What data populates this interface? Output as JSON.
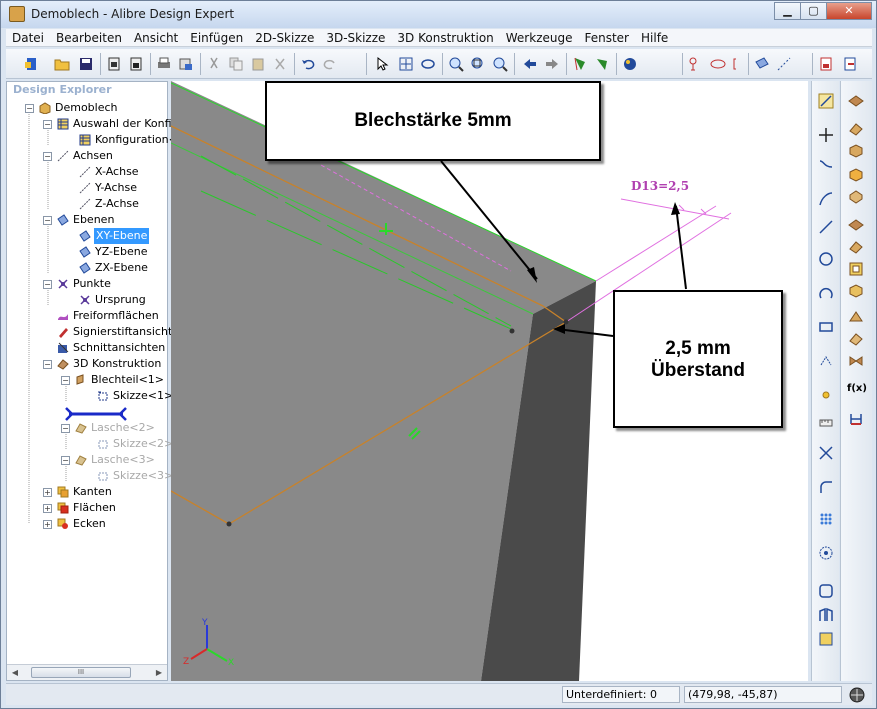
{
  "window": {
    "title": "Demoblech - Alibre Design Expert"
  },
  "menu": [
    "Datei",
    "Bearbeiten",
    "Ansicht",
    "Einfügen",
    "2D-Skizze",
    "3D-Skizze",
    "3D Konstruktion",
    "Werkzeuge",
    "Fenster",
    "Hilfe"
  ],
  "explorer": {
    "title": "Design Explorer",
    "tree": [
      {
        "label": "Demoblech",
        "icon": "part-icon"
      },
      {
        "label": "Auswahl der Konfigu",
        "icon": "table-icon"
      },
      {
        "label": "Konfiguration<1",
        "icon": "table-icon"
      },
      {
        "label": "Achsen",
        "icon": "axis-icon"
      },
      {
        "label": "X-Achse",
        "icon": "axis-icon"
      },
      {
        "label": "Y-Achse",
        "icon": "axis-icon"
      },
      {
        "label": "Z-Achse",
        "icon": "axis-icon"
      },
      {
        "label": "Ebenen",
        "icon": "plane-icon"
      },
      {
        "label": "XY-Ebene",
        "icon": "plane-icon"
      },
      {
        "label": "YZ-Ebene",
        "icon": "plane-icon"
      },
      {
        "label": "ZX-Ebene",
        "icon": "plane-icon"
      },
      {
        "label": "Punkte",
        "icon": "point-icon"
      },
      {
        "label": "Ursprung",
        "icon": "point-icon"
      },
      {
        "label": "Freiformflächen",
        "icon": "freeform-icon"
      },
      {
        "label": "Signierstiftansichten",
        "icon": "pen-icon"
      },
      {
        "label": "Schnittansichten",
        "icon": "section-icon"
      },
      {
        "label": "3D Konstruktion",
        "icon": "construction-icon"
      },
      {
        "label": "Blechteil<1>",
        "icon": "sheetmetal-icon"
      },
      {
        "label": "Skizze<1>",
        "icon": "sketch-icon"
      },
      {
        "label": "Lasche<2>",
        "icon": "tab-icon"
      },
      {
        "label": "Skizze<2>",
        "icon": "sketch-icon"
      },
      {
        "label": "Lasche<3>",
        "icon": "tab-icon"
      },
      {
        "label": "Skizze<3>",
        "icon": "sketch-icon"
      },
      {
        "label": "Kanten",
        "icon": "edges-icon"
      },
      {
        "label": "Flächen",
        "icon": "faces-icon"
      },
      {
        "label": "Ecken",
        "icon": "corners-icon"
      }
    ],
    "scroll_thumb": "III"
  },
  "viewport": {
    "callout_thickness": "Blechstärke 5mm",
    "callout_overhang_line1": "2,5 mm",
    "callout_overhang_line2": "Überstand",
    "dimension_label": "D13=2,5",
    "triad": {
      "x": "X",
      "y": "Y",
      "z": "Z"
    }
  },
  "status": {
    "constraint": "Unterdefiniert: 0",
    "coords": "(479,98, -45,87)"
  },
  "colors": {
    "part_face": "#898989",
    "part_side": "#4a4a4a",
    "sketch_orange": "#c8822a",
    "construction_green": "#3cc83c",
    "dimension_magenta": "#e070e0",
    "selection_blue": "#3399ff"
  }
}
